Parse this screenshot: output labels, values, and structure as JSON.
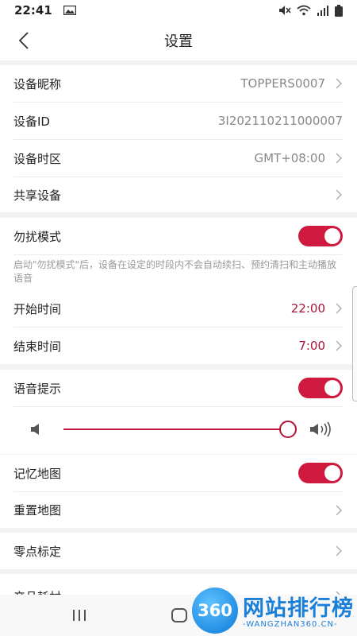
{
  "status_bar": {
    "time": "22:41"
  },
  "header": {
    "title": "设置"
  },
  "device": {
    "nickname_label": "设备昵称",
    "nickname_value": "TOPPERS0007",
    "id_label": "设备ID",
    "id_value": "3I202110211000007",
    "timezone_label": "设备时区",
    "timezone_value": "GMT+08:00",
    "share_label": "共享设备"
  },
  "dnd": {
    "label": "勿扰模式",
    "enabled": true,
    "description": "启动\"勿扰模式\"后，设备在设定的时段内不会自动续扫、预约清扫和主动播放语音",
    "start_label": "开始时间",
    "start_value": "22:00",
    "end_label": "结束时间",
    "end_value": "7:00"
  },
  "voice": {
    "label": "语音提示",
    "enabled": true,
    "volume_percent": 100
  },
  "map": {
    "memory_label": "记忆地图",
    "memory_enabled": true,
    "reset_label": "重置地图"
  },
  "calibration": {
    "label": "零点标定"
  },
  "consumables": {
    "label": "产品耗材"
  },
  "watermark": {
    "logo_text": "360",
    "title": "网站排行榜",
    "subtitle": "-WANGZHAN360.CN-"
  },
  "colors": {
    "accent": "#d0193f",
    "value_red": "#a4163a"
  }
}
